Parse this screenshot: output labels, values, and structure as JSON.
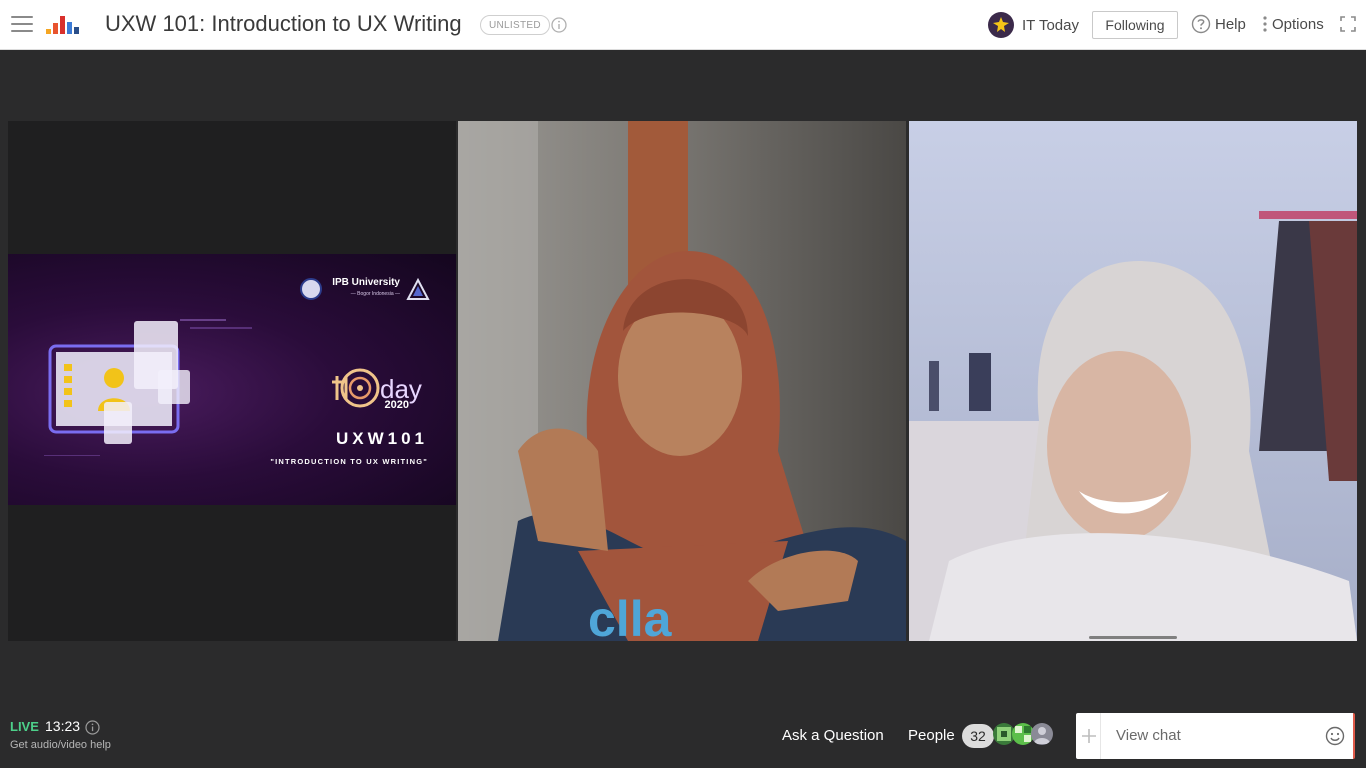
{
  "header": {
    "menu_icon": "hamburger-icon",
    "logo_icon": "crowdcast-logo-icon",
    "title": "UXW 101: Introduction to UX Writing",
    "badge": "UNLISTED",
    "info_icon": "info-icon",
    "organizer": "IT Today",
    "follow_label": "Following",
    "help_label": "Help",
    "options_label": "Options",
    "fullscreen_icon": "fullscreen-icon"
  },
  "stage": {
    "slide": {
      "brand": "IPB University",
      "brand_sub": "— Bogor Indonesia —",
      "year": "2020",
      "code": "UXW101",
      "subtitle": "\"INTRODUCTION TO UX WRITING\""
    }
  },
  "footer": {
    "live_label": "LIVE",
    "elapsed": "13:23",
    "av_help": "Get audio/video help",
    "ask_label": "Ask a Question",
    "people_label": "People",
    "people_count": "32",
    "chat_label": "View chat"
  },
  "colors": {
    "live": "#4dd08a",
    "stage_bg": "#2b2b2c",
    "slide_bg": "#2a0c3a",
    "chat_accent": "#e05a4a"
  }
}
